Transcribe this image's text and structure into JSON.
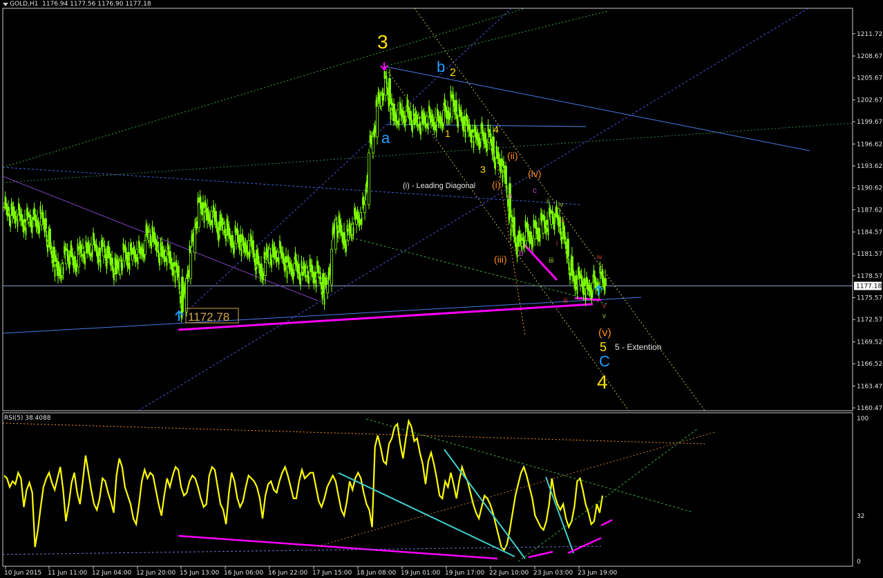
{
  "header": {
    "symbol": "GOLD,H1",
    "ohlc": "1176.94 1177.56 1176.90 1177.18"
  },
  "rsi_panel": {
    "title": "RSI(5) 38.4088",
    "levels": [
      "100",
      "32",
      "0"
    ]
  },
  "price_axis": {
    "ticks": [
      "1211.72",
      "1208.67",
      "1205.67",
      "1202.67",
      "1199.67",
      "1196.62",
      "1193.62",
      "1190.62",
      "1187.62",
      "1184.57",
      "1181.57",
      "1178.57",
      "1175.57",
      "1172.57",
      "1169.52",
      "1166.52",
      "1163.47",
      "1160.47"
    ],
    "current_price": "1177.18"
  },
  "time_axis": {
    "ticks": [
      "10 Jun 2015",
      "11 Jun 11:00",
      "12 Jun 04:00",
      "12 Jun 20:00",
      "15 Jun 13:00",
      "16 Jun 06:00",
      "16 Jun 22:00",
      "17 Jun 15:00",
      "18 Jun 08:00",
      "19 Jun 01:00",
      "19 Jun 17:00",
      "22 Jun 10:00",
      "23 Jun 03:00",
      "23 Jun 19:00"
    ]
  },
  "annotations": {
    "low_price": "1172.78",
    "wave_3_top": "3",
    "wave_a": "a",
    "wave_b": "b",
    "wave_2": "2",
    "wave_1": "1",
    "wave_4_small": "4",
    "wave_3_small": "3",
    "wave_ii_paren": "(ii)",
    "wave_iv_paren": "(iv)",
    "wave_i_paren": "(i)",
    "leading_diagonal": "(i) - Leading Diagonal",
    "wave_a_small": "a",
    "wave_c_small": "c",
    "wave_b_small": "b",
    "wave_iii_paren": "(iii)",
    "wave_ii_roman": "ii",
    "wave_iv_roman": "iv",
    "wave_i_roman": "i",
    "wave_iii_roman": "iii",
    "wave_iii_red": "iii",
    "wave_iv_red": "iv",
    "wave_ii_red": "ii",
    "wave_i_red": "i",
    "wave_v_red": "v",
    "wave_v_green": "v",
    "wave_v_paren": "(v)",
    "wave_5": "5",
    "extension": "5 - Extention",
    "wave_c_big": "C",
    "wave_4_big": "4"
  },
  "colors": {
    "background": "#000000",
    "candles": "#7CFC00",
    "rsi_line": "#FFFF00",
    "magenta": "#FF00FF",
    "wave_yellow": "#FFE000",
    "wave_orange": "#FF8C1A",
    "wave_blue": "#1EA0FF",
    "trend_blue": "#4A7BE8"
  },
  "chart_data": [
    {
      "type": "candlestick",
      "title": "GOLD,H1",
      "ylim": [
        1160.47,
        1213.5
      ],
      "x_ticks": [
        "10 Jun 2015",
        "11 Jun 11:00",
        "12 Jun 04:00",
        "12 Jun 20:00",
        "15 Jun 13:00",
        "16 Jun 06:00",
        "16 Jun 22:00",
        "17 Jun 15:00",
        "18 Jun 08:00",
        "19 Jun 01:00",
        "19 Jun 17:00",
        "22 Jun 10:00",
        "23 Jun 03:00",
        "23 Jun 19:00"
      ],
      "close_path": [
        [
          0,
          1188
        ],
        [
          6,
          1187.5
        ],
        [
          12,
          1186.8
        ],
        [
          18,
          1187
        ],
        [
          24,
          1186.3
        ],
        [
          30,
          1185.9
        ],
        [
          36,
          1186.6
        ],
        [
          42,
          1186.2
        ],
        [
          48,
          1185.5
        ],
        [
          54,
          1186.4
        ],
        [
          60,
          1185
        ],
        [
          66,
          1182.5
        ],
        [
          72,
          1180.5
        ],
        [
          78,
          1178.6
        ],
        [
          84,
          1180.2
        ],
        [
          90,
          1182
        ],
        [
          96,
          1181.2
        ],
        [
          102,
          1179.8
        ],
        [
          108,
          1181.5
        ],
        [
          114,
          1182.3
        ],
        [
          120,
          1181.7
        ],
        [
          126,
          1182.8
        ],
        [
          132,
          1182.4
        ],
        [
          138,
          1181.3
        ],
        [
          144,
          1182.6
        ],
        [
          150,
          1181
        ],
        [
          156,
          1180.2
        ],
        [
          162,
          1178.8
        ],
        [
          168,
          1180.6
        ],
        [
          174,
          1181.8
        ],
        [
          180,
          1180.7
        ],
        [
          186,
          1181.5
        ],
        [
          192,
          1182.2
        ],
        [
          198,
          1181.5
        ],
        [
          204,
          1183.4
        ],
        [
          210,
          1184.5
        ],
        [
          216,
          1183.2
        ],
        [
          222,
          1182.6
        ],
        [
          228,
          1181.2
        ],
        [
          234,
          1181.9
        ],
        [
          240,
          1180.4
        ],
        [
          246,
          1179.9
        ],
        [
          252,
          1178.4
        ],
        [
          258,
          1173.6
        ],
        [
          264,
          1178.2
        ],
        [
          270,
          1181.7
        ],
        [
          276,
          1185.2
        ],
        [
          282,
          1188.6
        ],
        [
          288,
          1187.8
        ],
        [
          294,
          1186.2
        ],
        [
          300,
          1187.4
        ],
        [
          306,
          1186
        ],
        [
          312,
          1184.8
        ],
        [
          318,
          1185.6
        ],
        [
          324,
          1184.1
        ],
        [
          330,
          1183
        ],
        [
          336,
          1184.2
        ],
        [
          342,
          1183.1
        ],
        [
          348,
          1181.8
        ],
        [
          354,
          1183.4
        ],
        [
          360,
          1182.1
        ],
        [
          366,
          1180.2
        ],
        [
          372,
          1178.6
        ],
        [
          378,
          1180.4
        ],
        [
          384,
          1182.2
        ],
        [
          390,
          1181.1
        ],
        [
          396,
          1181.8
        ],
        [
          402,
          1181.2
        ],
        [
          408,
          1180.4
        ],
        [
          414,
          1179.4
        ],
        [
          420,
          1180.2
        ],
        [
          426,
          1179.1
        ],
        [
          432,
          1178.6
        ],
        [
          438,
          1179.6
        ],
        [
          444,
          1179.1
        ],
        [
          450,
          1178.4
        ],
        [
          456,
          1178.9
        ],
        [
          462,
          1176.2
        ],
        [
          468,
          1177.4
        ],
        [
          474,
          1182.2
        ],
        [
          480,
          1186.2
        ],
        [
          486,
          1184.5
        ],
        [
          492,
          1183.4
        ],
        [
          498,
          1184.2
        ],
        [
          504,
          1185.6
        ],
        [
          510,
          1186.3
        ],
        [
          516,
          1187.2
        ],
        [
          522,
          1188.3
        ],
        [
          528,
          1195.4
        ],
        [
          534,
          1197.6
        ],
        [
          540,
          1201.8
        ],
        [
          546,
          1203.3
        ],
        [
          552,
          1205.6
        ],
        [
          558,
          1202.1
        ],
        [
          564,
          1199.8
        ],
        [
          570,
          1201.3
        ],
        [
          576,
          1200.4
        ],
        [
          582,
          1201.1
        ],
        [
          588,
          1200.2
        ],
        [
          594,
          1199.3
        ],
        [
          600,
          1200.1
        ],
        [
          606,
          1199.4
        ],
        [
          612,
          1200.4
        ],
        [
          618,
          1199.6
        ],
        [
          624,
          1200.3
        ],
        [
          630,
          1199.5
        ],
        [
          636,
          1201.2
        ],
        [
          642,
          1200.3
        ],
        [
          648,
          1202.6
        ],
        [
          654,
          1201.1
        ],
        [
          660,
          1200.4
        ],
        [
          666,
          1199.2
        ],
        [
          672,
          1198.6
        ],
        [
          678,
          1198.2
        ],
        [
          684,
          1197.3
        ],
        [
          690,
          1198.1
        ],
        [
          696,
          1196.8
        ],
        [
          702,
          1197.6
        ],
        [
          708,
          1195.4
        ],
        [
          714,
          1194.6
        ],
        [
          720,
          1193.6
        ],
        [
          726,
          1191.2
        ],
        [
          732,
          1186.6
        ],
        [
          738,
          1184.1
        ],
        [
          744,
          1182.6
        ],
        [
          750,
          1183.4
        ],
        [
          756,
          1184.6
        ],
        [
          762,
          1183.6
        ],
        [
          768,
          1185.1
        ],
        [
          774,
          1184.4
        ],
        [
          780,
          1186.2
        ],
        [
          786,
          1185.6
        ],
        [
          792,
          1187.1
        ],
        [
          798,
          1186.6
        ],
        [
          804,
          1185.4
        ],
        [
          810,
          1183.6
        ],
        [
          816,
          1181.2
        ],
        [
          822,
          1178.6
        ],
        [
          828,
          1177.4
        ],
        [
          834,
          1178.2
        ],
        [
          840,
          1177.2
        ],
        [
          846,
          1176.6
        ],
        [
          852,
          1177.6
        ],
        [
          858,
          1177.1
        ],
        [
          864,
          1178.2
        ],
        [
          870,
          1177.18
        ]
      ]
    },
    {
      "type": "line",
      "title": "RSI(5) 38.4088",
      "ylim": [
        0,
        100
      ],
      "levels": [
        32
      ],
      "values": [
        60,
        58,
        52,
        56,
        54,
        62,
        58,
        38,
        50,
        55,
        48,
        10,
        22,
        38,
        52,
        58,
        62,
        55,
        50,
        58,
        66,
        50,
        28,
        40,
        55,
        62,
        48,
        40,
        56,
        74,
        62,
        50,
        40,
        36,
        44,
        58,
        56,
        48,
        42,
        34,
        60,
        72,
        66,
        52,
        46,
        40,
        30,
        26,
        40,
        56,
        64,
        58,
        62,
        60,
        50,
        40,
        32,
        46,
        58,
        52,
        60,
        66,
        64,
        52,
        46,
        48,
        56,
        60,
        58,
        52,
        44,
        38,
        40,
        60,
        66,
        64,
        52,
        40,
        36,
        26,
        48,
        62,
        56,
        44,
        38,
        42,
        52,
        60,
        58,
        56,
        52,
        44,
        30,
        46,
        54,
        56,
        50,
        48,
        56,
        62,
        66,
        60,
        52,
        44,
        44,
        56,
        64,
        58,
        60,
        62,
        62,
        52,
        42,
        38,
        44,
        52,
        56,
        60,
        56,
        46,
        36,
        32,
        42,
        56,
        50,
        58,
        62,
        58,
        48,
        40,
        36,
        24,
        80,
        88,
        80,
        70,
        68,
        82,
        86,
        94,
        96,
        82,
        72,
        86,
        98,
        94,
        84,
        86,
        76,
        68,
        54,
        70,
        76,
        68,
        58,
        46,
        44,
        56,
        52,
        62,
        54,
        44,
        56,
        66,
        60,
        56,
        48,
        40,
        34,
        30,
        38,
        46,
        44,
        40,
        34,
        26,
        18,
        10,
        8,
        12,
        22,
        34,
        46,
        54,
        62,
        66,
        60,
        52,
        44,
        32,
        28,
        24,
        22,
        28,
        40,
        58,
        46,
        40,
        36,
        40,
        30,
        24,
        28,
        38,
        56,
        58,
        50,
        40,
        34,
        26,
        28,
        40,
        34,
        46
      ]
    }
  ]
}
